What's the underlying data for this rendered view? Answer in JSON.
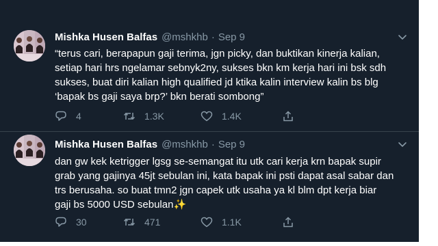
{
  "tweets": [
    {
      "name": "Mishka Husen Balfas",
      "handle": "@mshkhb",
      "separator": "·",
      "date": "Sep 9",
      "lines": [
        "“terus cari, berapapun gaji terima, jgn picky, dan buktikan kinerja kalian,",
        "setiap hari hrs ngelamar sebnyk2ny, sukses bkn km kerja hari ini bsk sdh",
        "sukses, buat diri kalian high qualified jd ktika kalin interview kalin bs blg",
        "‘bapak bs gaji saya brp?’ bkn berati sombong”"
      ],
      "replies": "4",
      "retweets": "1.3K",
      "likes": "1.4K"
    },
    {
      "name": "Mishka Husen Balfas",
      "handle": "@mshkhb",
      "separator": "·",
      "date": "Sep 9",
      "lines": [
        "dan gw kek ketrigger lgsg se-semangat itu utk cari kerja krn bapak supir",
        "grab yang gajinya 45jt sebulan ini, kata bapak ini psti dapat asal sabar dan",
        "trs berusaha. so buat tmn2 jgn capek utk usaha ya kl blm dpt kerja biar",
        "gaji bs 5000 USD sebulan✨"
      ],
      "replies": "30",
      "retweets": "471",
      "likes": "1.1K"
    }
  ],
  "icons": {
    "reply": "reply-icon",
    "retweet": "retweet-icon",
    "like": "heart-icon",
    "share": "share-icon",
    "more": "chevron-down-icon"
  },
  "colors": {
    "background": "#16202c",
    "text": "#ffffff",
    "secondary": "#8899a6",
    "divider": "#38444d"
  }
}
